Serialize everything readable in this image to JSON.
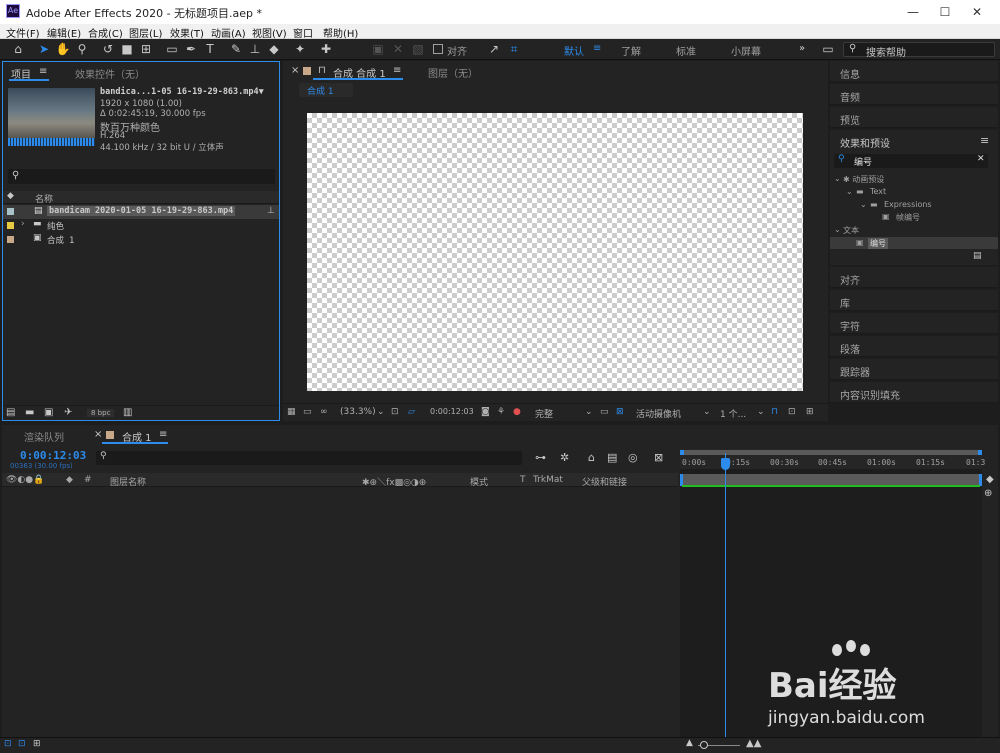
{
  "window": {
    "title": "Adobe After Effects 2020 - 无标题项目.aep *",
    "logo": "Ae",
    "minimize": "—",
    "maximize": "☐",
    "close": "✕"
  },
  "menu": [
    "文件(F)",
    "编辑(E)",
    "合成(C)",
    "图层(L)",
    "效果(T)",
    "动画(A)",
    "视图(V)",
    "窗口",
    "帮助(H)"
  ],
  "toolbar": {
    "snap_label": "对齐",
    "workspaces": [
      "默认",
      "了解",
      "标准",
      "小屏幕"
    ],
    "active_workspace": "默认",
    "more": "»",
    "search_help": "搜索帮助"
  },
  "project_panel": {
    "tabs": [
      "项目",
      "效果控件（无）"
    ],
    "footage": {
      "name": "bandica...1-05 16-19-29-863.mp4▼",
      "resolution": "1920 x 1080 (1.00)",
      "duration": "Δ 0:02:45:19, 30.000 fps",
      "colors": "数百万种颜色",
      "codec": "H.264",
      "audio": "44.100 kHz / 32 bit U / 立体声"
    },
    "search_placeholder": "",
    "column_name": "名称",
    "items": [
      {
        "name": "bandicam 2020-01-05 16-19-29-863.mp4",
        "color": "#a8c0c8",
        "type": "file",
        "selected": true
      },
      {
        "name": "纯色",
        "color": "#e8c840",
        "type": "folder",
        "selected": false
      },
      {
        "name": "合成 1",
        "color": "#c8a888",
        "type": "comp",
        "selected": false
      }
    ],
    "bpc": "8 bpc"
  },
  "comp_panel": {
    "tab_label": "合成 合成 1",
    "layer_tab": "图层（无）",
    "breadcrumb": "合成 1",
    "zoom": "(33.3%)",
    "timecode": "0:00:12:03",
    "resolution": "完整",
    "camera": "活动摄像机",
    "views": "1 个..."
  },
  "right_panels": {
    "items_top": [
      "信息",
      "音频",
      "预览"
    ],
    "effects_title": "效果和预设",
    "effects_search": "编号",
    "tree": [
      {
        "label": "✱ 动画预设",
        "indent": 0
      },
      {
        "label": "Text",
        "indent": 1
      },
      {
        "label": "Expressions",
        "indent": 2
      },
      {
        "label": "帧编号",
        "indent": 3
      },
      {
        "label": "文本",
        "indent": 0
      },
      {
        "label": "编号",
        "indent": 1
      }
    ],
    "items_bottom": [
      "对齐",
      "库",
      "字符",
      "段落",
      "跟踪器",
      "内容识别填充"
    ]
  },
  "timeline": {
    "tabs": [
      "渲染队列",
      "合成 1"
    ],
    "timecode": "0:00:12:03",
    "frame_info": "00363 (30.00 fps)",
    "columns": [
      "图层名称",
      "模式",
      "T",
      "TrkMat",
      "父级和链接"
    ],
    "ruler": [
      "0:00s",
      "0:15s",
      "00:30s",
      "00:45s",
      "01:00s",
      "01:15s",
      "01:3"
    ],
    "cti_position_fraction": 0.14
  },
  "watermark": {
    "brand": "Bai经验",
    "url": "jingyan.baidu.com"
  },
  "colors": {
    "accent": "#2d8ceb",
    "panel": "#232323",
    "selected_row": "#5a5a5a",
    "work_area_bar": "#22bb22"
  }
}
